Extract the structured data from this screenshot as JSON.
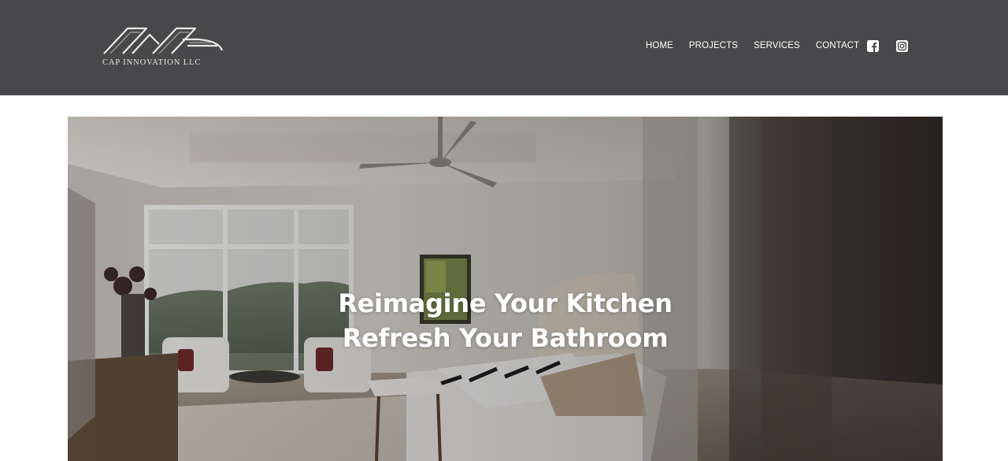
{
  "brand": {
    "name": "CAP INNOVATION LLC"
  },
  "nav": {
    "items": [
      {
        "label": "HOME"
      },
      {
        "label": "PROJECTS"
      },
      {
        "label": "SERVICES"
      },
      {
        "label": "CONTACT"
      }
    ]
  },
  "social": {
    "facebook_icon": "facebook-square-icon",
    "instagram_icon": "instagram-icon"
  },
  "hero": {
    "line1": "Reimagine Your Kitchen",
    "line2": "Refresh Your Bathroom"
  },
  "colors": {
    "header_bg": "#48484a",
    "nav_text": "#ffffff",
    "hero_text": "#ffffff"
  }
}
